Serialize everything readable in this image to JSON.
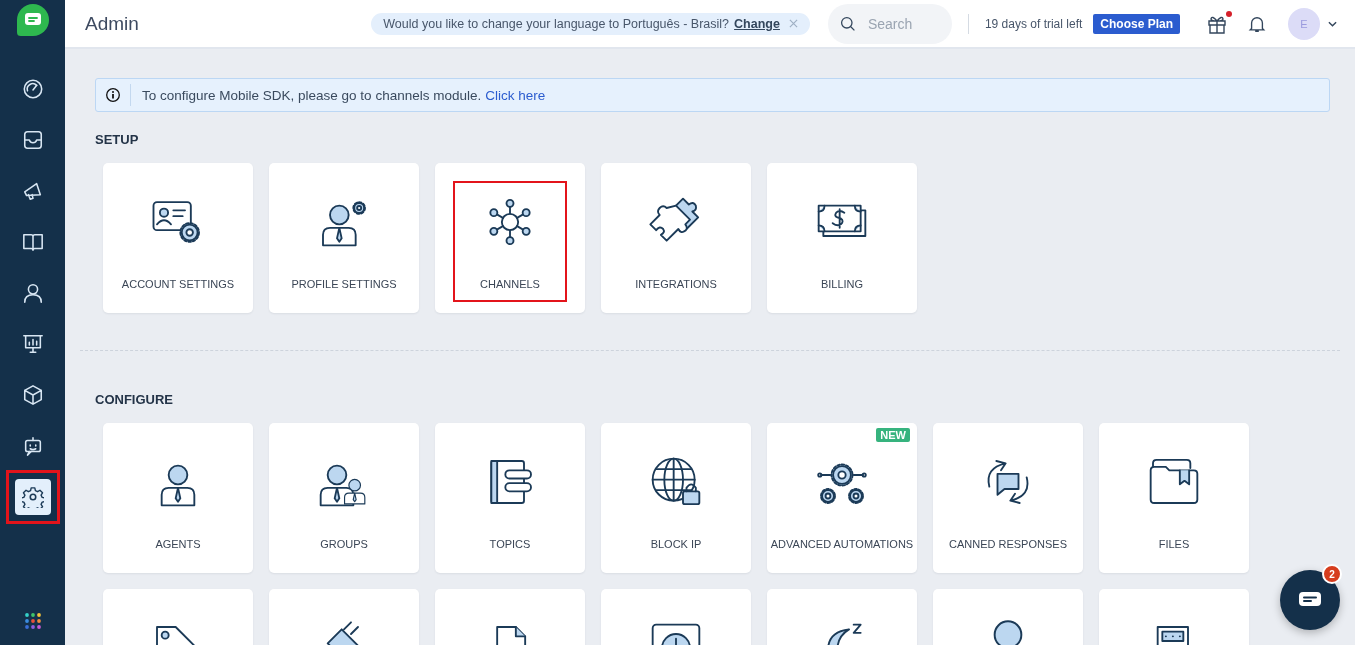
{
  "header": {
    "title": "Admin",
    "language_prompt": {
      "text": "Would you like to change your language to Português - Brasil?",
      "link": "Change"
    },
    "search": {
      "placeholder": "Search"
    },
    "trial": "19 days of trial left",
    "plan_button": "Choose Plan",
    "gift_notification": true,
    "avatar": "E"
  },
  "sidebar": {
    "items": [
      {
        "selected": false,
        "highlighted": false
      },
      {
        "selected": false,
        "highlighted": false
      },
      {
        "selected": false,
        "highlighted": false
      },
      {
        "selected": false,
        "highlighted": false
      },
      {
        "selected": false,
        "highlighted": false
      },
      {
        "selected": false,
        "highlighted": false
      },
      {
        "selected": false,
        "highlighted": false
      },
      {
        "selected": false,
        "highlighted": false
      },
      {
        "selected": true,
        "highlighted": true
      }
    ]
  },
  "banner": {
    "text": "To configure Mobile SDK, please go to channels module.",
    "link": "Click here"
  },
  "sections": [
    {
      "title": "SETUP",
      "cards": [
        {
          "label": "ACCOUNT SETTINGS",
          "highlighted": false
        },
        {
          "label": "PROFILE SETTINGS",
          "highlighted": false
        },
        {
          "label": "CHANNELS",
          "highlighted": true
        },
        {
          "label": "INTEGRATIONS",
          "highlighted": false
        },
        {
          "label": "BILLING",
          "highlighted": false
        }
      ]
    },
    {
      "title": "CONFIGURE",
      "cards": [
        {
          "label": "AGENTS",
          "highlighted": false
        },
        {
          "label": "GROUPS",
          "highlighted": false
        },
        {
          "label": "TOPICS",
          "highlighted": false
        },
        {
          "label": "BLOCK IP",
          "highlighted": false
        },
        {
          "label": "ADVANCED AUTOMATIONS",
          "highlighted": false,
          "badge": "NEW"
        },
        {
          "label": "CANNED RESPONSES",
          "highlighted": false
        },
        {
          "label": "FILES",
          "highlighted": false
        },
        {
          "highlighted": false
        },
        {
          "highlighted": false
        },
        {
          "highlighted": false
        },
        {
          "highlighted": false
        },
        {
          "highlighted": false
        },
        {
          "highlighted": false
        },
        {
          "highlighted": false
        }
      ]
    }
  ],
  "chat": {
    "badge": "2"
  }
}
